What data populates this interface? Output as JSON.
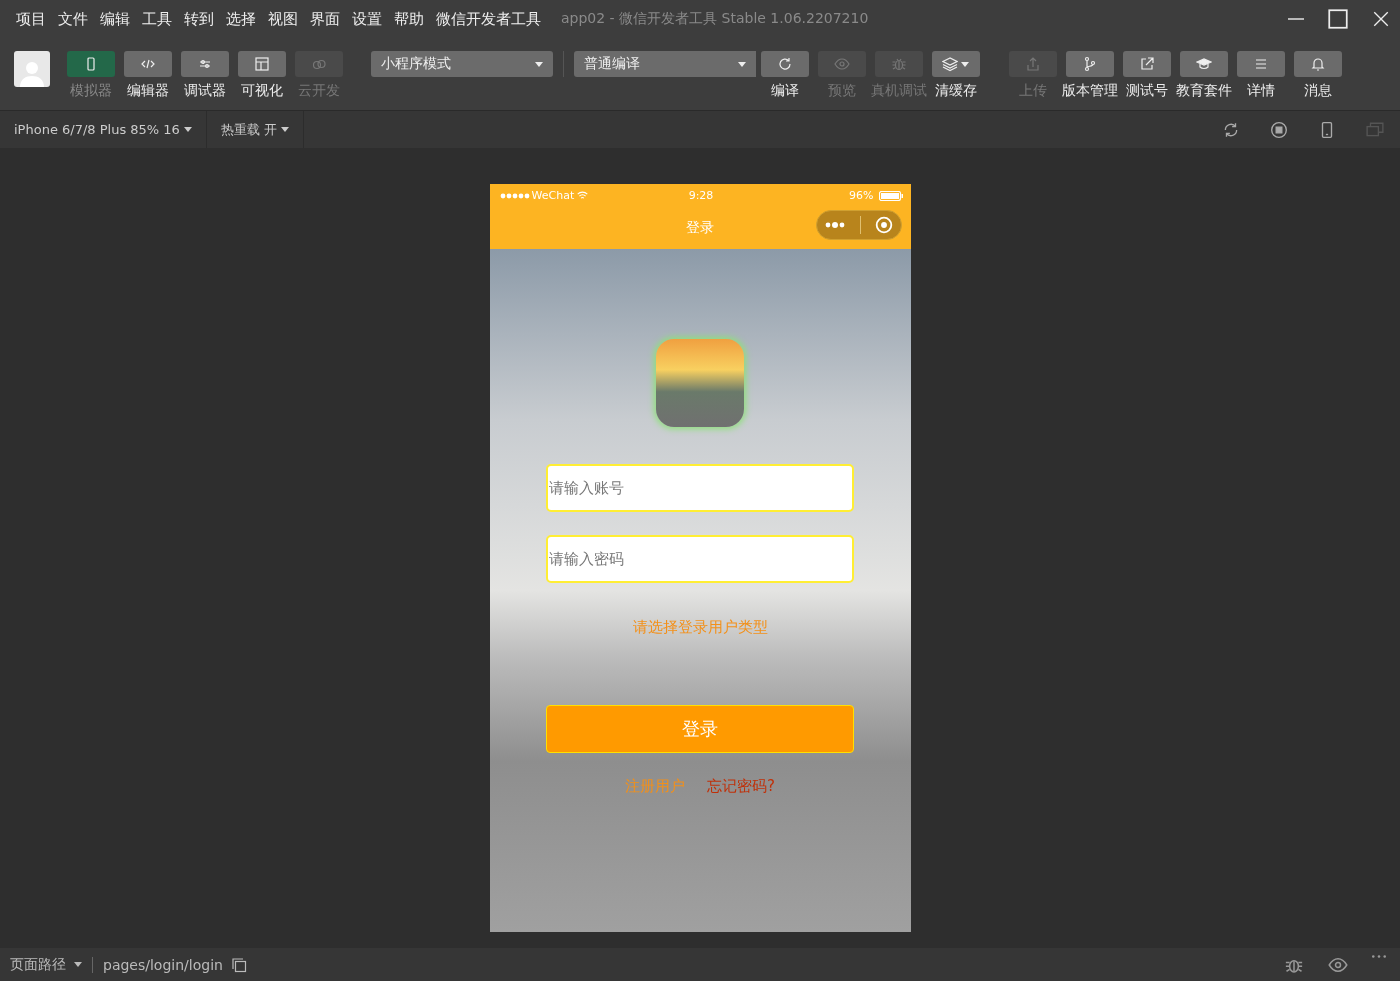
{
  "menu": [
    "项目",
    "文件",
    "编辑",
    "工具",
    "转到",
    "选择",
    "视图",
    "界面",
    "设置",
    "帮助",
    "微信开发者工具"
  ],
  "window": {
    "title": "app02 - 微信开发者工具 Stable 1.06.2207210"
  },
  "toolbar": {
    "left_tools": [
      {
        "label": "模拟器",
        "selected": true,
        "disabled": false
      },
      {
        "label": "编辑器",
        "selected": false,
        "disabled": false
      },
      {
        "label": "调试器",
        "selected": false,
        "disabled": false
      },
      {
        "label": "可视化",
        "selected": false,
        "disabled": false
      },
      {
        "label": "云开发",
        "selected": false,
        "disabled": true
      }
    ],
    "mode_dropdown": "小程序模式",
    "compile_dropdown": "普通编译",
    "right_tools": [
      {
        "label": "编译",
        "disabled": false
      },
      {
        "label": "预览",
        "disabled": true
      },
      {
        "label": "真机调试",
        "disabled": true
      },
      {
        "label": "清缓存",
        "disabled": false
      },
      {
        "label": "上传",
        "disabled": true
      },
      {
        "label": "版本管理",
        "disabled": false
      },
      {
        "label": "测试号",
        "disabled": false
      },
      {
        "label": "教育套件",
        "disabled": false
      },
      {
        "label": "详情",
        "disabled": false
      },
      {
        "label": "消息",
        "disabled": false
      }
    ]
  },
  "device_bar": {
    "device": "iPhone 6/7/8 Plus 85% 16",
    "hot_reload": "热重载 开"
  },
  "phone": {
    "carrier": "WeChat",
    "time": "9:28",
    "battery": "96%",
    "nav_title": "登录",
    "account_placeholder": "请输入账号",
    "password_placeholder": "请输入密码",
    "user_type_link": "请选择登录用户类型",
    "login_button": "登录",
    "register_link": "注册用户",
    "forgot_link": "忘记密码?"
  },
  "status_bar": {
    "path_label": "页面路径",
    "path": "pages/login/login"
  }
}
